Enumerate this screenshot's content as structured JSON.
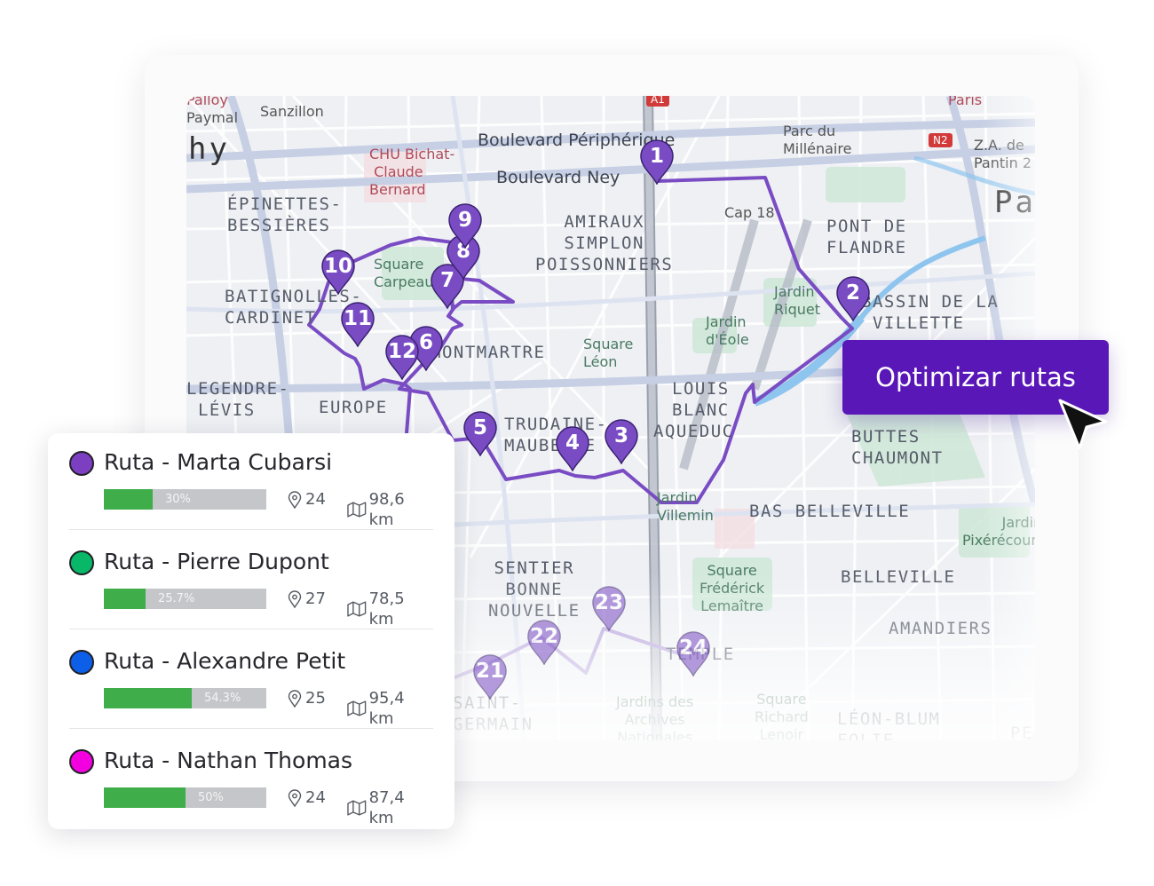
{
  "map": {
    "labels": {
      "palloy": "Palloy",
      "paymal": "Paymal",
      "sanzillon": "Sanzillon",
      "hy": "hy",
      "chu": "CHU Bichat-\n Claude\nBernard",
      "peripherique": "Boulevard Périphérique",
      "ney": "Boulevard Ney",
      "parc_millenaire": "Parc du\nMillénaire",
      "za_pantin": "Z.A. de\nPantin 2",
      "paris": "Paris",
      "pa": "Pa",
      "epinettes": "ÉPINETTES-\nBESSIÈRES",
      "amiraux": "AMIRAUX\nSIMPLON\nPOISSONNIERS",
      "cap18": "Cap 18",
      "pont_flandre": "PONT DE\nFLANDRE",
      "square_carpeaux": "Square\nCarpeaux",
      "batignolles": "BATIGNOLLES-\nCARDINET",
      "jardin_riquet": "Jardin\nRiquet",
      "bassin": "BASSIN DE LA\n VILLETTE",
      "jardin_eole": "Jardin\nd'Éole",
      "montmartre": "MONTMARTRE",
      "square_leon": "Square\nLéon",
      "legendre": "LEGENDRE-\n LÉVIS",
      "europe": "EUROPE",
      "louis_blanc": "LOUIS\nBLANC",
      "aqueduc": "AQUEDUC",
      "trudaine": "TRUDAINE-\nMAUBEUGE",
      "buttes": "BUTTES\nCHAUMONT",
      "jardin_villemin": "Jardin\nVillemin",
      "bas_belleville": "BAS BELLEVILLE",
      "jardin_pixerecourt": "Jardin\nPixérécourt",
      "sentier": "SENTIER\nBONNE\nNOUVELLE",
      "square_lemaitre": "Square\nFrédérick\nLemaître",
      "belleville": "BELLEVILLE",
      "amandiers": "AMANDIERS",
      "temple": "TEMPLE",
      "saint_germain": "SAINT-\nGERMAIN",
      "jardins_archives": "Jardins des\nArchives\nNationales",
      "square_richard": "Square\nRichard\nLenoir",
      "leon_blum": "LÉON-BLUM\nFOLIE-",
      "pe": "PE",
      "shield_a1": "A1",
      "shield_n2": "N2"
    },
    "stops": [
      "1",
      "2",
      "3",
      "4",
      "5",
      "6",
      "7",
      "8",
      "9",
      "10",
      "11",
      "12",
      "21",
      "22",
      "23",
      "24"
    ],
    "route_color": "#7a4cc4",
    "faded_route_color": "#b7a3dc"
  },
  "cta": {
    "label": "Optimizar rutas",
    "color": "#5a17b8"
  },
  "routes": [
    {
      "name": "Ruta - Marta Cubarsi",
      "color": "#7c3fc2",
      "progress": 0.3,
      "progress_label": "30%",
      "stops": "24",
      "distance": "98,6 km"
    },
    {
      "name": "Ruta - Pierre Dupont",
      "color": "#08b868",
      "progress": 0.257,
      "progress_label": "25.7%",
      "stops": "27",
      "distance": "78,5 km"
    },
    {
      "name": "Ruta - Alexandre Petit",
      "color": "#0d5fe8",
      "progress": 0.543,
      "progress_label": "54.3%",
      "stops": "25",
      "distance": "95,4 km"
    },
    {
      "name": "Ruta - Nathan Thomas",
      "color": "#f200e0",
      "progress": 0.5,
      "progress_label": "50%",
      "stops": "24",
      "distance": "87,4 km"
    }
  ]
}
